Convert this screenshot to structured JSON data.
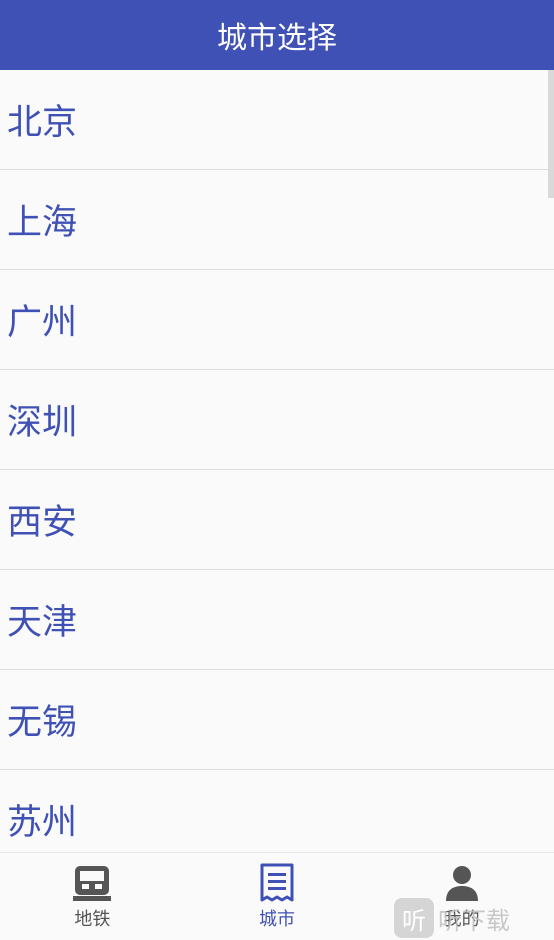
{
  "app_bar": {
    "title": "城市选择",
    "background": "#3f51b5"
  },
  "cities": [
    {
      "name": "北京"
    },
    {
      "name": "上海"
    },
    {
      "name": "广州"
    },
    {
      "name": "深圳"
    },
    {
      "name": "西安"
    },
    {
      "name": "天津"
    },
    {
      "name": "无锡"
    },
    {
      "name": "苏州"
    }
  ],
  "bottom_nav": {
    "items": [
      {
        "label": "地铁",
        "icon": "subway-icon",
        "active": false
      },
      {
        "label": "城市",
        "icon": "list-document-icon",
        "active": true
      },
      {
        "label": "我的",
        "icon": "person-icon",
        "active": false
      }
    ],
    "active_color": "#3f51b5",
    "inactive_color": "#555555"
  },
  "watermark": {
    "badge": "听",
    "text": "听下载"
  }
}
